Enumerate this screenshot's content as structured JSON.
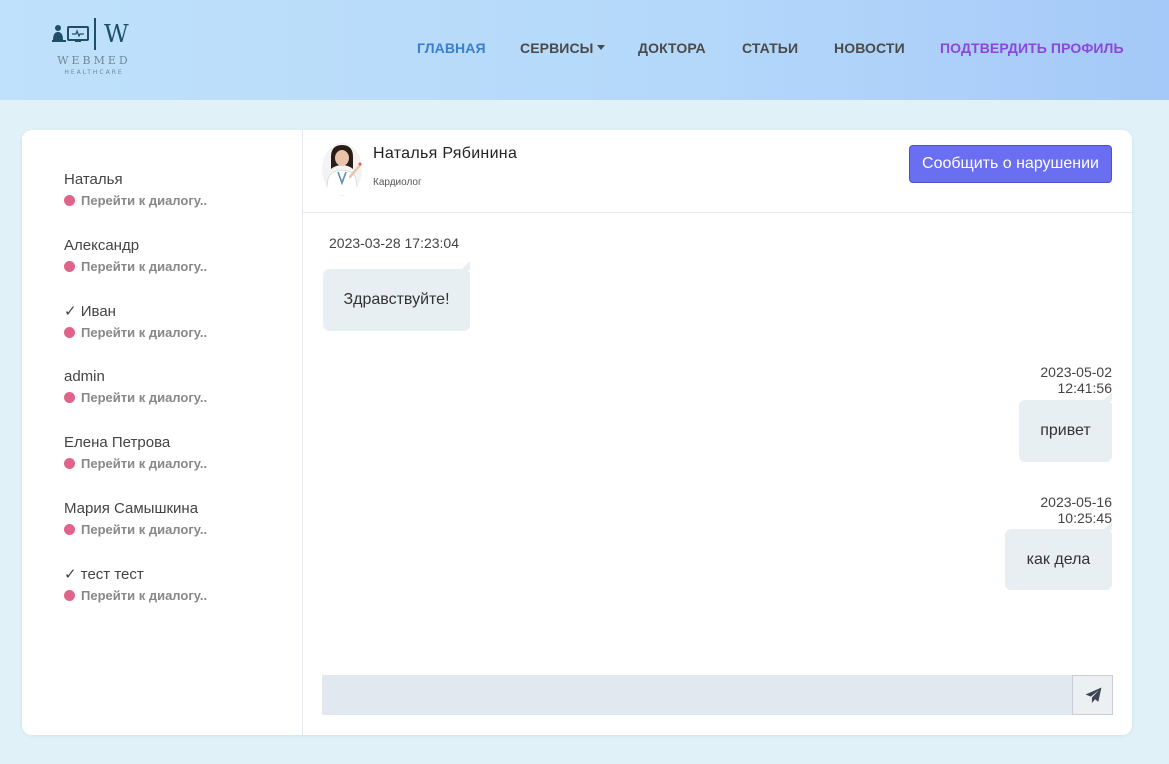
{
  "logo": {
    "word": "WEBMED",
    "subword": "HEALTHCARE",
    "letter": "W"
  },
  "nav": {
    "home": "ГЛАВНАЯ",
    "services": "СЕРВИСЫ",
    "doctors": "ДОКТОРА",
    "articles": "СТАТЬИ",
    "news": "НОВОСТИ",
    "confirm_profile": "ПОДТВЕРДИТЬ ПРОФИЛЬ"
  },
  "contacts": [
    {
      "name": "Наталья",
      "status": "Перейти к диалогу.."
    },
    {
      "name": "Александр",
      "status": "Перейти к диалогу.."
    },
    {
      "name": "✓ Иван",
      "status": "Перейти к диалогу.."
    },
    {
      "name": "admin",
      "status": "Перейти к диалогу.."
    },
    {
      "name": "Елена Петрова",
      "status": "Перейти к диалогу.."
    },
    {
      "name": "Мария Самышкина",
      "status": "Перейти к диалогу.."
    },
    {
      "name": "✓ тест тест",
      "status": "Перейти к диалогу.."
    }
  ],
  "chat": {
    "doctor_name": "Наталья Рябинина",
    "doctor_role": "Кардиолог",
    "report_button": "Сообщить о нарушении",
    "messages": [
      {
        "time": "2023-03-28 17:23:04",
        "text": "Здравствуйте!",
        "side": "left"
      },
      {
        "time": "2023-05-02 12:41:56",
        "text": "привет",
        "side": "right"
      },
      {
        "time": "2023-05-16 10:25:45",
        "text": "как дела",
        "side": "right"
      }
    ],
    "input_value": "",
    "input_placeholder": ""
  },
  "colors": {
    "accent": "#6a6ef0",
    "nav_active": "#3a7dd1",
    "nav_purple": "#8c45e0",
    "status_dot": "#e0638a",
    "bubble": "#e8eff2"
  },
  "icons": {
    "send": "paper-plane-icon",
    "caret": "caret-down-icon"
  }
}
